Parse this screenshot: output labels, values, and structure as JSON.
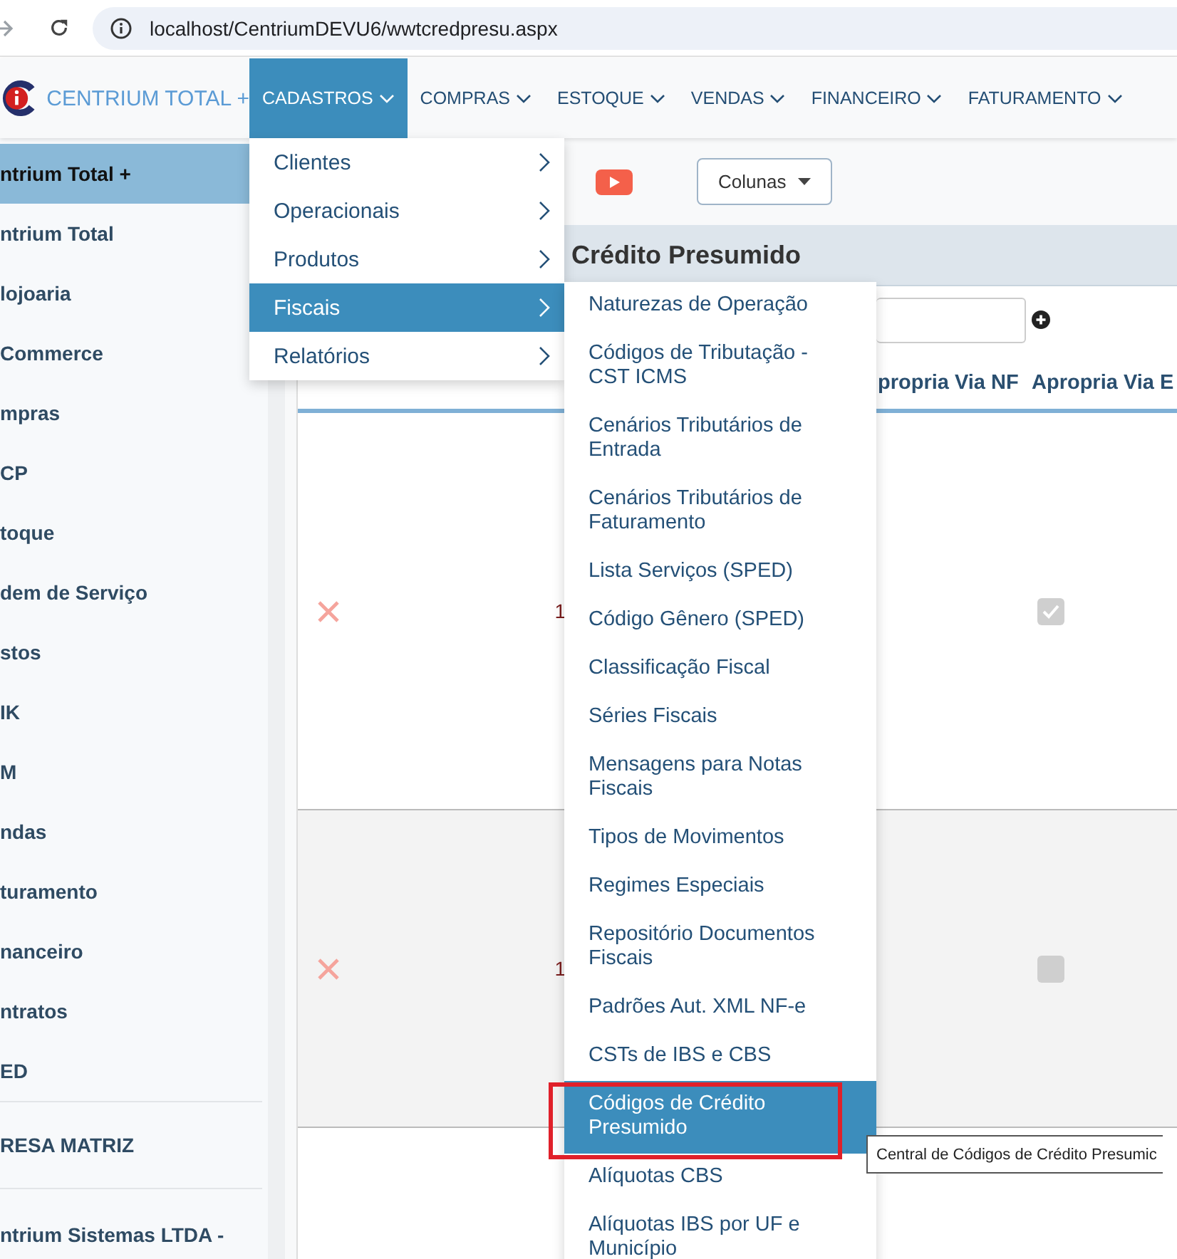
{
  "browser": {
    "url": "localhost/CentriumDEVU6/wwtcredpresu.aspx"
  },
  "navbar": {
    "brand": "CENTRIUM TOTAL +",
    "menu": [
      {
        "label": "CADASTROS",
        "selected": true
      },
      {
        "label": "COMPRAS",
        "selected": false
      },
      {
        "label": "ESTOQUE",
        "selected": false
      },
      {
        "label": "VENDAS",
        "selected": false
      },
      {
        "label": "FINANCEIRO",
        "selected": false
      },
      {
        "label": "FATURAMENTO",
        "selected": false
      }
    ]
  },
  "sidebar": {
    "items": [
      {
        "label": "ntrium Total +",
        "selected": true
      },
      {
        "label": "ntrium Total",
        "selected": false
      },
      {
        "label": "lojoaria",
        "selected": false
      },
      {
        "label": "Commerce",
        "selected": false
      },
      {
        "label": "mpras",
        "selected": false
      },
      {
        "label": "CP",
        "selected": false
      },
      {
        "label": "toque",
        "selected": false
      },
      {
        "label": "dem de Serviço",
        "selected": false
      },
      {
        "label": "stos",
        "selected": false
      },
      {
        "label": "IK",
        "selected": false
      },
      {
        "label": "M",
        "selected": false
      },
      {
        "label": "ndas",
        "selected": false
      },
      {
        "label": "turamento",
        "selected": false
      },
      {
        "label": "nanceiro",
        "selected": false
      },
      {
        "label": "ntratos",
        "selected": false
      },
      {
        "label": "ED",
        "selected": false
      }
    ],
    "company": "RESA MATRIZ",
    "account": "ntrium Sistemas LTDA -"
  },
  "toolbar": {
    "columns_button": "Colunas"
  },
  "grid": {
    "title": "Crédito Presumido",
    "columns": [
      "propria Via NF",
      "Apropria Via E"
    ],
    "rows": [
      {
        "column_2": "1",
        "checked": true
      },
      {
        "column_2": "1",
        "checked": false
      }
    ]
  },
  "cadastros_menu": {
    "items": [
      {
        "label": "Clientes",
        "selected": false
      },
      {
        "label": "Operacionais",
        "selected": false
      },
      {
        "label": "Produtos",
        "selected": false
      },
      {
        "label": "Fiscais",
        "selected": true
      },
      {
        "label": "Relatórios",
        "selected": false
      }
    ]
  },
  "fiscais_menu": {
    "items": [
      {
        "label": "Naturezas de Operação",
        "selected": false
      },
      {
        "label": "Códigos de Tributação - CST ICMS",
        "selected": false
      },
      {
        "label": "Cenários Tributários de Entrada",
        "selected": false
      },
      {
        "label": "Cenários Tributários de Faturamento",
        "selected": false
      },
      {
        "label": "Lista Serviços (SPED)",
        "selected": false
      },
      {
        "label": "Código Gênero (SPED)",
        "selected": false
      },
      {
        "label": "Classificação Fiscal",
        "selected": false
      },
      {
        "label": "Séries Fiscais",
        "selected": false
      },
      {
        "label": "Mensagens para Notas Fiscais",
        "selected": false
      },
      {
        "label": "Tipos de Movimentos",
        "selected": false
      },
      {
        "label": "Regimes Especiais",
        "selected": false
      },
      {
        "label": "Repositório Documentos Fiscais",
        "selected": false
      },
      {
        "label": "Padrões Aut. XML NF-e",
        "selected": false
      },
      {
        "label": "CSTs de IBS e CBS",
        "selected": false
      },
      {
        "label": "Códigos de Crédito Presumido",
        "selected": true
      },
      {
        "label": "Alíquotas CBS",
        "selected": false
      },
      {
        "label": "Alíquotas IBS por UF e Município",
        "selected": false
      }
    ]
  },
  "tooltip": "Central de Códigos de Crédito Presumic"
}
